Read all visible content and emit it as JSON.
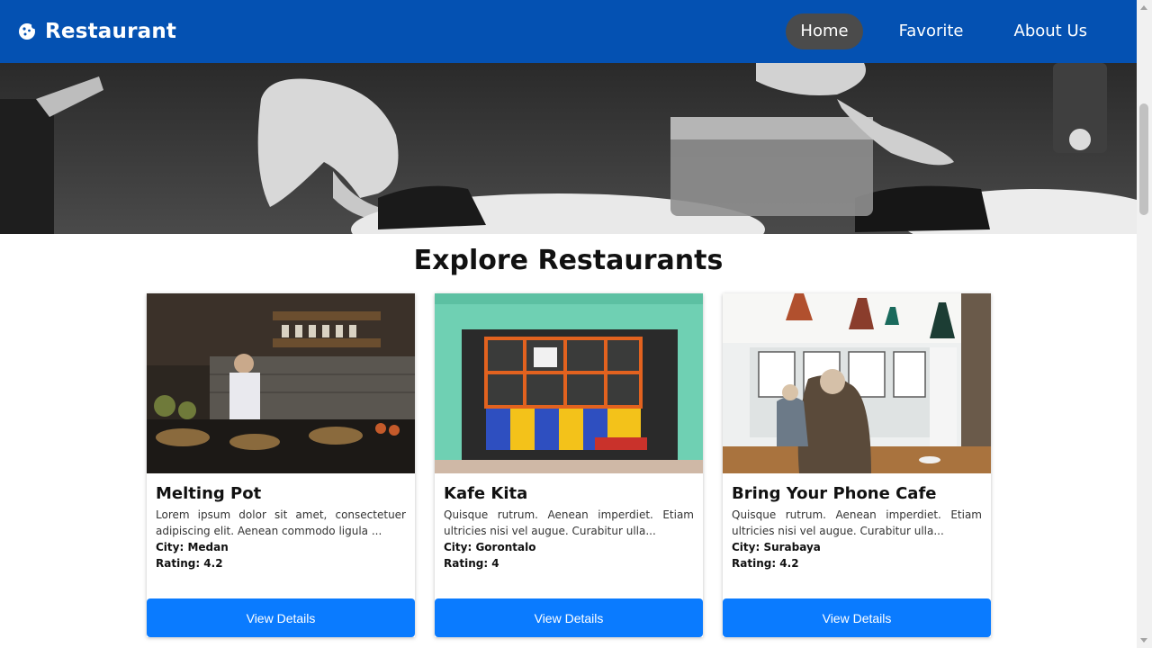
{
  "brand": {
    "name": "Restaurant",
    "icon": "cookie-icon"
  },
  "nav": {
    "items": [
      {
        "label": "Home",
        "active": true
      },
      {
        "label": "Favorite",
        "active": false
      },
      {
        "label": "About Us",
        "active": false
      }
    ]
  },
  "hero": {
    "image": "chef-plating-photo"
  },
  "main": {
    "title": "Explore Restaurants"
  },
  "restaurants": [
    {
      "name": "Melting Pot",
      "description": "Lorem ipsum dolor sit amet, consectetuer adipiscing elit. Aenean commodo ligula ...",
      "city": "City: Medan",
      "rating": "Rating: 4.2",
      "button": "View Details"
    },
    {
      "name": "Kafe Kita",
      "description": "Quisque rutrum. Aenean imperdiet. Etiam ultricies nisi vel augue. Curabitur ulla...",
      "city": "City: Gorontalo",
      "rating": "Rating: 4",
      "button": "View Details"
    },
    {
      "name": "Bring Your Phone Cafe",
      "description": "Quisque rutrum. Aenean imperdiet. Etiam ultricies nisi vel augue. Curabitur ulla...",
      "city": "City: Surabaya",
      "rating": "Rating: 4.2",
      "button": "View Details"
    }
  ],
  "colors": {
    "navbar": "#0451b2",
    "active_nav": "#4b4b4b",
    "button": "#0a7bff"
  }
}
